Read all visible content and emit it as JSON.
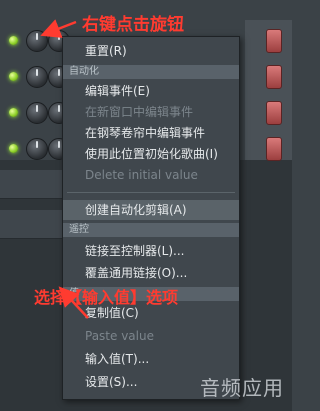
{
  "annotations": {
    "top": "右键点击旋钮",
    "middle": "选择【输入值】选项"
  },
  "watermark": "音频应用",
  "menu": {
    "items": [
      {
        "label": "重置(R)",
        "disabled": false
      },
      {
        "section": "自动化"
      },
      {
        "label": "编辑事件(E)",
        "disabled": false
      },
      {
        "label": "在新窗口中编辑事件",
        "disabled": true
      },
      {
        "label": "在钢琴卷帘中编辑事件",
        "disabled": false
      },
      {
        "label": "使用此位置初始化歌曲(I)",
        "disabled": false
      },
      {
        "label": "Delete initial value",
        "disabled": true
      },
      {
        "label": "创建自动化剪辑(A)",
        "disabled": false,
        "highlighted": true
      },
      {
        "section": "遥控"
      },
      {
        "label": "链接至控制器(L)...",
        "disabled": false
      },
      {
        "label": "覆盖通用链接(O)...",
        "disabled": false
      },
      {
        "section": "值"
      },
      {
        "label": "复制值(C)",
        "disabled": false
      },
      {
        "label": "Paste value",
        "disabled": true
      },
      {
        "label": "输入值(T)...",
        "disabled": false
      },
      {
        "label": "设置(S)...",
        "disabled": false
      }
    ]
  },
  "colors": {
    "annotation": "#ff3b30",
    "menu_bg": "#40474d",
    "section_bg": "#59626a",
    "highlight_bg": "#5a6369"
  }
}
